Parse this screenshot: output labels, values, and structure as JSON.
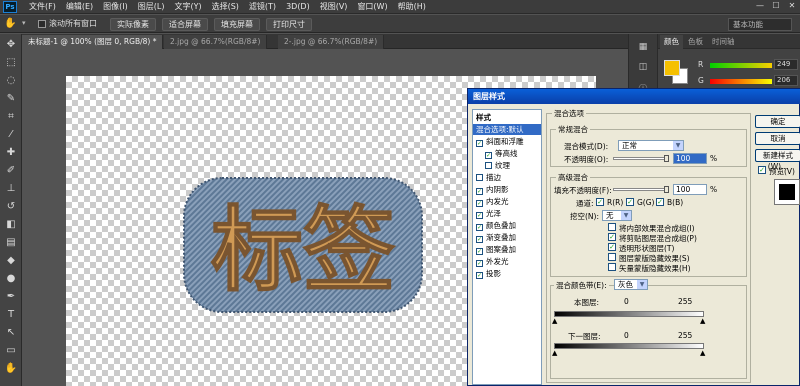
{
  "app": {
    "logo": "Ps"
  },
  "menubar": {
    "items": [
      "文件(F)",
      "编辑(E)",
      "图像(I)",
      "图层(L)",
      "文字(Y)",
      "选择(S)",
      "滤镜(T)",
      "3D(D)",
      "视图(V)",
      "窗口(W)",
      "帮助(H)"
    ],
    "window_controls": [
      "—",
      "☐",
      "✕"
    ]
  },
  "optionsbar": {
    "tool_icon": "hand-icon",
    "scroll_all": "滚动所有窗口",
    "buttons": [
      "实际像素",
      "适合屏幕",
      "填充屏幕",
      "打印尺寸"
    ],
    "workspace": "基本功能"
  },
  "document_tabs": [
    {
      "label": "未标题-1 @ 100% (图层 0, RGB/8) *",
      "active": true
    },
    {
      "label": "2.jpg @ 66.7%(RGB/8#)",
      "active": false
    },
    {
      "label": "2-.jpg @ 66.7%(RGB/8#)",
      "active": false
    }
  ],
  "artwork": {
    "text": "标签",
    "fill": "#d09a55",
    "outline": "#5a7491"
  },
  "color_panel": {
    "tabs": [
      "颜色",
      "色板",
      "时间轴"
    ],
    "foreground": "#f5c000",
    "background": "#ffffff",
    "channels": [
      {
        "label": "R",
        "value": "249"
      },
      {
        "label": "G",
        "value": "206"
      }
    ]
  },
  "dialog": {
    "title": "图层样式",
    "styles_header": "样式",
    "styles": [
      {
        "label": "混合选项:默认",
        "checkbox": false,
        "checked": false,
        "selected": true
      },
      {
        "label": "斜面和浮雕",
        "checkbox": true,
        "checked": true
      },
      {
        "label": "等高线",
        "checkbox": true,
        "checked": true,
        "indent": true
      },
      {
        "label": "纹理",
        "checkbox": true,
        "checked": false,
        "indent": true
      },
      {
        "label": "描边",
        "checkbox": true,
        "checked": false
      },
      {
        "label": "内阴影",
        "checkbox": true,
        "checked": true
      },
      {
        "label": "内发光",
        "checkbox": true,
        "checked": true
      },
      {
        "label": "光泽",
        "checkbox": true,
        "checked": true
      },
      {
        "label": "颜色叠加",
        "checkbox": true,
        "checked": true
      },
      {
        "label": "渐变叠加",
        "checkbox": true,
        "checked": true
      },
      {
        "label": "图案叠加",
        "checkbox": true,
        "checked": true
      },
      {
        "label": "外发光",
        "checkbox": true,
        "checked": true
      },
      {
        "label": "投影",
        "checkbox": true,
        "checked": true
      }
    ],
    "blend_options": {
      "title": "混合选项",
      "general": {
        "title": "常规混合",
        "mode_label": "混合模式(D):",
        "mode_value": "正常",
        "opacity_label": "不透明度(O):",
        "opacity_value": "100",
        "unit": "%"
      },
      "advanced": {
        "title": "高级混合",
        "fill_opacity_label": "填充不透明度(F):",
        "fill_opacity_value": "100",
        "unit": "%",
        "channels_label": "通道:",
        "channels": [
          "R(R)",
          "G(G)",
          "B(B)"
        ],
        "knockout_label": "挖空(N):",
        "knockout_value": "无",
        "options": [
          {
            "label": "将内部效果混合成组(I)",
            "checked": false
          },
          {
            "label": "将剪贴图层混合成组(P)",
            "checked": true
          },
          {
            "label": "透明形状图层(T)",
            "checked": true
          },
          {
            "label": "图层蒙版隐藏效果(S)",
            "checked": false
          },
          {
            "label": "矢量蒙版隐藏效果(H)",
            "checked": false
          }
        ]
      },
      "blend_if": {
        "label": "混合颜色带(E):",
        "value": "灰色",
        "this_layer": "本图层:",
        "underlying": "下一图层:",
        "min": "0",
        "max": "255"
      }
    },
    "buttons": [
      "确定",
      "取消",
      "新建样式(W)..."
    ],
    "preview_label": "预览(V)"
  }
}
